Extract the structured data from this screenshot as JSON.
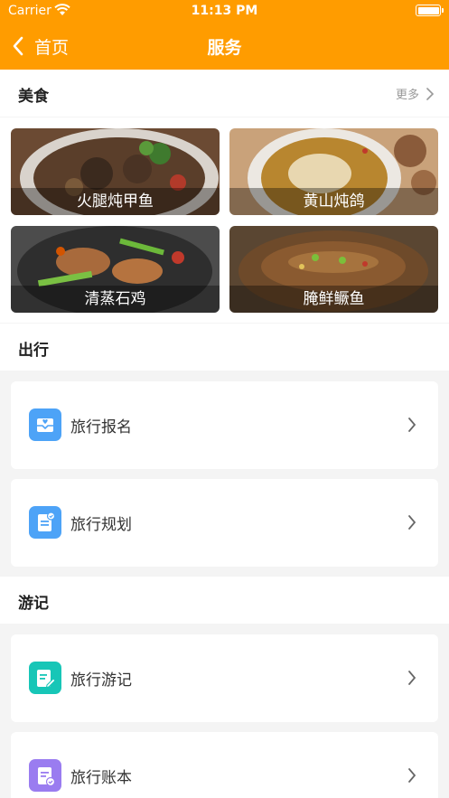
{
  "status_bar": {
    "carrier": "Carrier",
    "time": "11:13 PM"
  },
  "nav": {
    "back_label": "首页",
    "title": "服务"
  },
  "food_section": {
    "title": "美食",
    "more_label": "更多",
    "items": [
      {
        "label": "火腿炖甲鱼"
      },
      {
        "label": "黄山炖鸽"
      },
      {
        "label": "清蒸石鸡"
      },
      {
        "label": "腌鲜鳜鱼"
      }
    ]
  },
  "travel_section": {
    "title": "出行",
    "items": [
      {
        "label": "旅行报名",
        "icon": "envelope-heart-icon",
        "color": "#4da3f7"
      },
      {
        "label": "旅行规划",
        "icon": "document-check-icon",
        "color": "#4da3f7"
      }
    ]
  },
  "journal_section": {
    "title": "游记",
    "items": [
      {
        "label": "旅行游记",
        "icon": "edit-note-icon",
        "color": "#17c6b7"
      },
      {
        "label": "旅行账本",
        "icon": "ledger-check-icon",
        "color": "#9a7cf0"
      }
    ]
  },
  "colors": {
    "brand": "#ff9c00",
    "background": "#f4f4f4"
  }
}
